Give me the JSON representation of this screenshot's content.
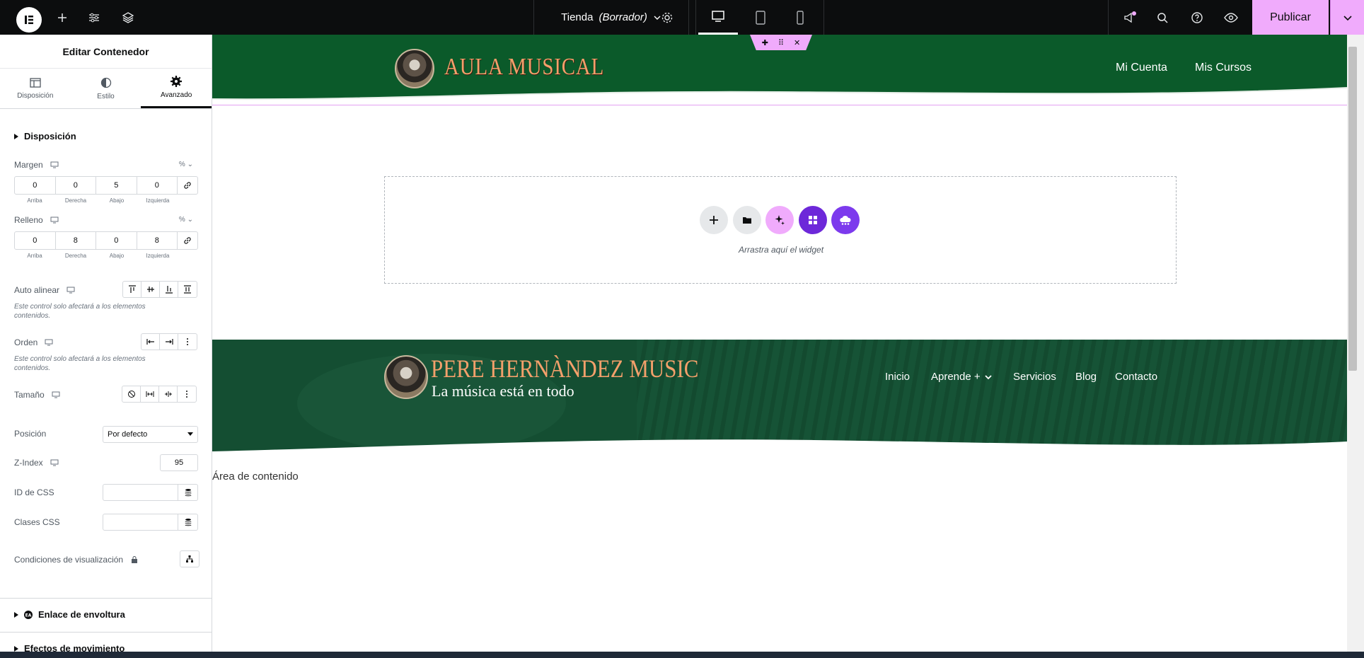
{
  "topbar": {
    "document": {
      "name": "Tienda",
      "status": "(Borrador)"
    },
    "publish_label": "Publicar"
  },
  "panel": {
    "title": "Editar Contenedor",
    "tabs": [
      {
        "label": "Disposición",
        "icon": "layout-icon"
      },
      {
        "label": "Estilo",
        "icon": "half-circle-icon"
      },
      {
        "label": "Avanzado",
        "icon": "gear-icon",
        "active": true
      }
    ],
    "section_disposicion": "Disposición",
    "margin": {
      "label": "Margen",
      "unit": "%",
      "values": [
        "0",
        "0",
        "5",
        "0"
      ]
    },
    "padding": {
      "label": "Relleno",
      "unit": "%",
      "values": [
        "0",
        "8",
        "0",
        "8"
      ]
    },
    "dim_labels": [
      "Arriba",
      "Derecha",
      "Abajo",
      "Izquierda"
    ],
    "auto_align": {
      "label": "Auto alinear",
      "note": "Este control solo afectará a los elementos contenidos."
    },
    "order": {
      "label": "Orden",
      "note": "Este control solo afectará a los elementos contenidos."
    },
    "size": {
      "label": "Tamaño"
    },
    "position": {
      "label": "Posición",
      "value": "Por defecto"
    },
    "zindex": {
      "label": "Z-Index",
      "value": "95"
    },
    "css_id": {
      "label": "ID de CSS"
    },
    "css_classes": {
      "label": "Clases CSS"
    },
    "display_conditions": {
      "label": "Condiciones de visualización"
    },
    "section_wrapper_link": "Enlace de envoltura",
    "section_motion": "Efectos de movimiento"
  },
  "canvas": {
    "header": {
      "brand": "AULA MUSICAL",
      "nav": [
        "Mi Cuenta",
        "Mis Cursos"
      ]
    },
    "dropzone_text": "Arrastra aquí el widget",
    "footer": {
      "brand": "PERE HERNÀNDEZ MUSIC",
      "tagline": "La música está en todo",
      "nav": [
        "Inicio",
        "Aprende +",
        "Servicios",
        "Blog",
        "Contacto"
      ]
    },
    "content_area": "Área de contenido"
  },
  "colors": {
    "accent": "#f0abfc",
    "header_green": "#0b5a2a",
    "brand_orange": "#f3a06b",
    "dark": "#0c0d0e"
  }
}
